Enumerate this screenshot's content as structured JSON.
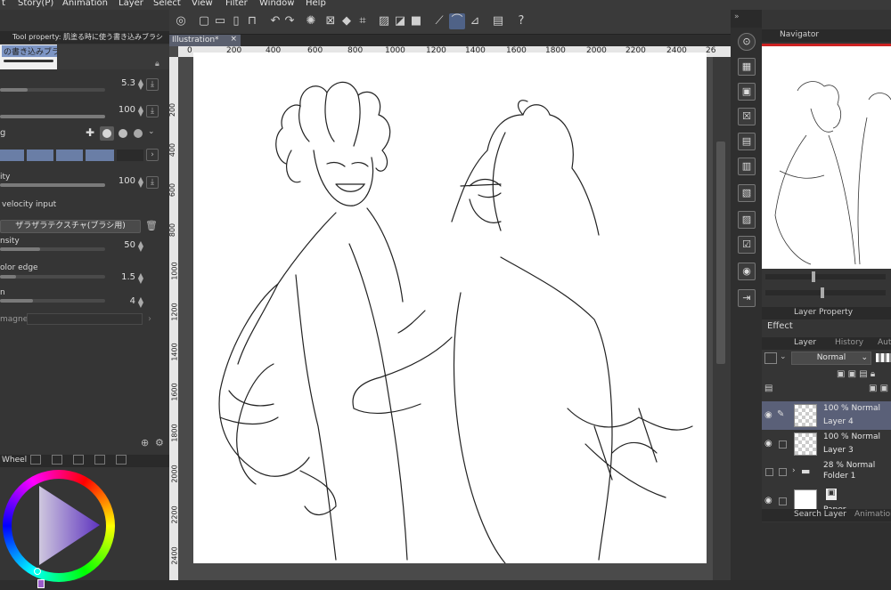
{
  "menu": [
    "t",
    "Story(P)",
    "Animation",
    "Layer",
    "Select",
    "View",
    "Filter",
    "Window",
    "Help"
  ],
  "tool_property": {
    "tab_title": "Tool property: 肌塗る時に使う書き込みブラシ",
    "brush_name": "の書き込みブラシ",
    "rows": [
      {
        "label": "",
        "value": "5.3",
        "fill": 0.17
      },
      {
        "label": "",
        "value": "100",
        "fill": 1.0
      },
      {
        "label": "g",
        "value": ""
      },
      {
        "label": "",
        "value": ""
      },
      {
        "label": "ity",
        "value": "100",
        "fill": 1.0
      },
      {
        "label": "velocity input",
        "value": ""
      },
      {
        "label": "",
        "texture_button": "ザラザラテクスチャ(ブラシ用)"
      },
      {
        "label": "nsity",
        "value": "50",
        "fill": 0.5
      },
      {
        "label": "olor edge",
        "value": "1.5",
        "fill": 0.15
      },
      {
        "label": "n",
        "value": "4",
        "fill": 0.4
      },
      {
        "label": "magnet",
        "value": ""
      }
    ]
  },
  "color_wheel": {
    "tab_label": "Wheel"
  },
  "document": {
    "tab_label": "Illustration*",
    "close": "×"
  },
  "ruler": {
    "h_ticks": [
      "0",
      "200",
      "400",
      "600",
      "800",
      "1000",
      "1200",
      "1400",
      "1600",
      "1800",
      "2000",
      "2200",
      "2400",
      "26"
    ],
    "v_ticks": [
      "200",
      "400",
      "600",
      "800",
      "1000",
      "1200",
      "1400",
      "1600",
      "1800",
      "2000",
      "2200",
      "2400"
    ]
  },
  "navigator": {
    "tab_label": "Navigator"
  },
  "layer_property": {
    "tab_label": "Layer Property",
    "effect_label": "Effect"
  },
  "layer_panel": {
    "tabs": [
      "Layer",
      "History",
      "Auto"
    ],
    "blend_mode": "Normal",
    "layers": [
      {
        "opacity": "100 % Normal",
        "name": "Layer 4",
        "selected": true
      },
      {
        "opacity": "100 % Normal",
        "name": "Layer 3",
        "selected": false
      },
      {
        "opacity": "28 % Normal",
        "name": "Folder 1",
        "selected": false
      },
      {
        "opacity": "",
        "name": "Paper",
        "selected": false
      }
    ]
  },
  "bottom_tabs": [
    "Search Layer",
    "Animation"
  ],
  "colors": {
    "accent": "#4f6287",
    "selected_layer": "#5a6078",
    "panel": "#353535"
  }
}
